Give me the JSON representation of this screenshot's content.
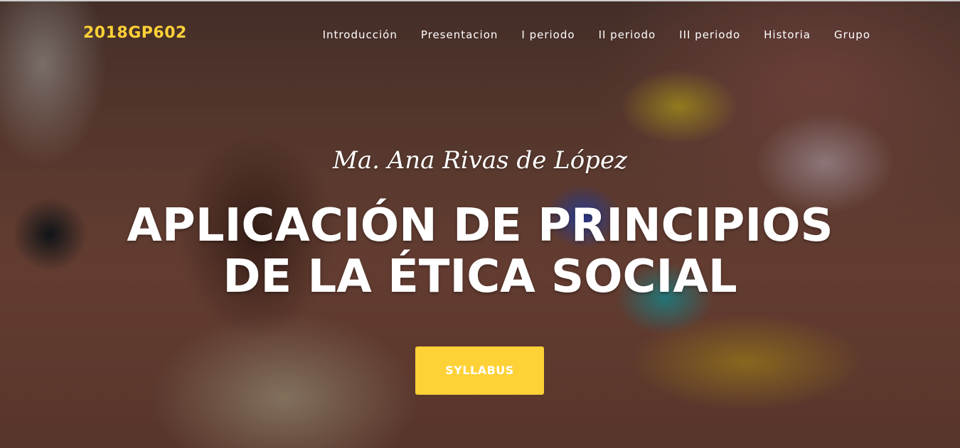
{
  "nav": {
    "brand": "2018GP602",
    "items": [
      {
        "label": "Introducción"
      },
      {
        "label": "Presentacion"
      },
      {
        "label": "I periodo"
      },
      {
        "label": "II periodo"
      },
      {
        "label": "III periodo"
      },
      {
        "label": "Historia"
      },
      {
        "label": "Grupo"
      }
    ]
  },
  "hero": {
    "subtitle": "Ma. Ana Rivas de López",
    "title_line1": "APLICACIÓN DE PRINCIPIOS",
    "title_line2": "DE LA ÉTICA SOCIAL",
    "button_label": "SYLLABUS"
  },
  "colors": {
    "accent": "#fed136",
    "text": "#ffffff"
  }
}
